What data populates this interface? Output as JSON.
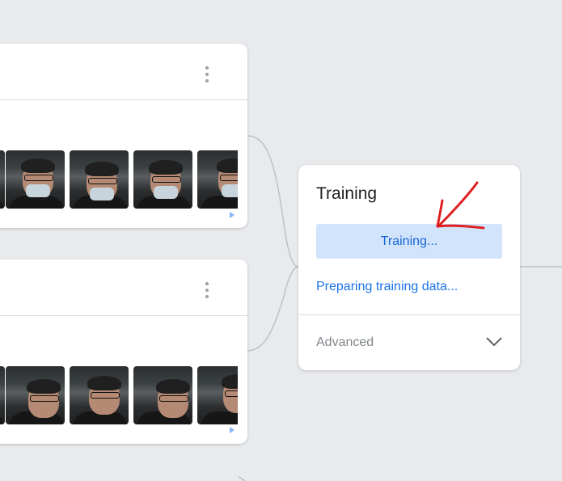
{
  "training_card": {
    "title": "Training",
    "train_button_label": "Training...",
    "status_text": "Preparing training data...",
    "advanced_label": "Advanced"
  },
  "icons": {
    "menu": "more-vert-icon",
    "expand": "chevron-down-icon",
    "scroll": "scroll-right-icon"
  },
  "colors": {
    "canvas": "#e8eaed",
    "button_bg": "#d2e3fc",
    "accent_text": "#1a73e8",
    "annotation": "#e02020"
  }
}
